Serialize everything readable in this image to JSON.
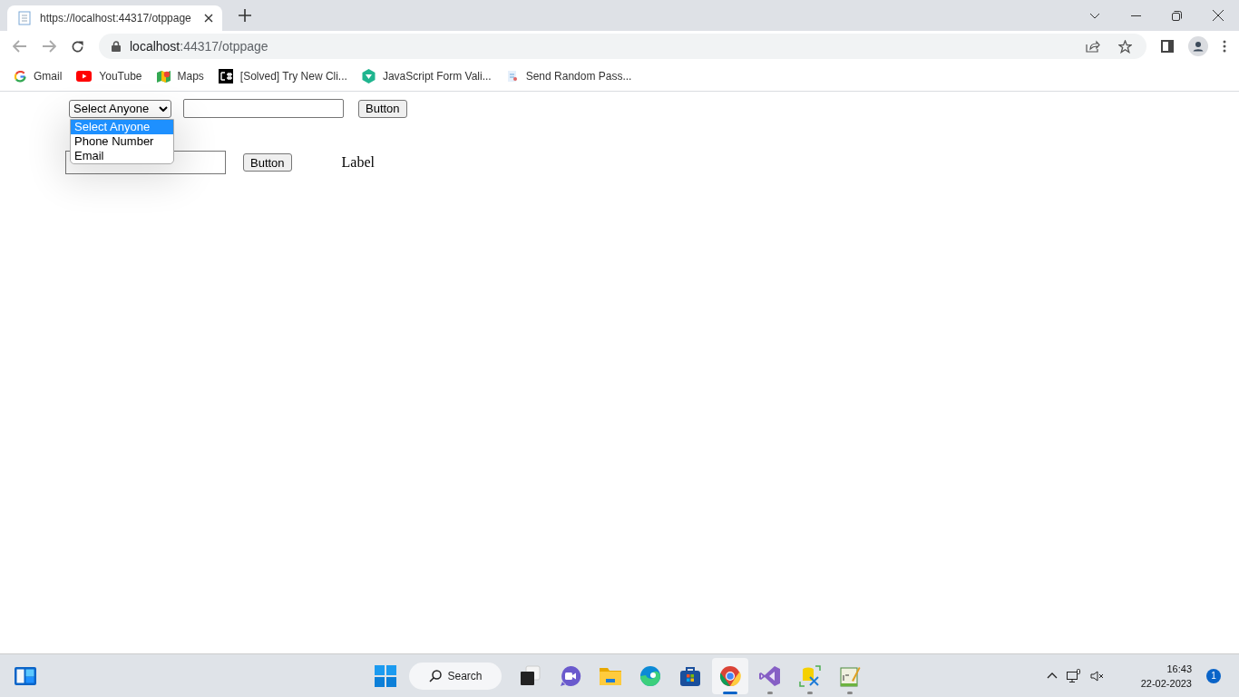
{
  "browser": {
    "tab_title": "https://localhost:44317/otppage",
    "address": {
      "host": "localhost",
      "path": ":44317/otppage"
    },
    "bookmarks": [
      {
        "kind": "google",
        "label": "Gmail"
      },
      {
        "kind": "youtube",
        "label": "YouTube"
      },
      {
        "kind": "maps",
        "label": "Maps"
      },
      {
        "kind": "csharp",
        "label": "[Solved] Try New Cli..."
      },
      {
        "kind": "shield",
        "label": "JavaScript Form Vali..."
      },
      {
        "kind": "page",
        "label": "Send Random Pass..."
      }
    ]
  },
  "page": {
    "select": {
      "value": "Select Anyone",
      "open": true,
      "options": [
        {
          "label": "Select Anyone",
          "selected": true
        },
        {
          "label": "Phone Number",
          "selected": false
        },
        {
          "label": "Email",
          "selected": false
        }
      ]
    },
    "button_1": "Button",
    "button_2": "Button",
    "label": "Label"
  },
  "taskbar": {
    "search": "Search",
    "apps": [
      {
        "kind": "taskview",
        "running": false,
        "active": false
      },
      {
        "kind": "chat",
        "running": false,
        "active": false
      },
      {
        "kind": "folder",
        "running": false,
        "active": false
      },
      {
        "kind": "edge",
        "running": false,
        "active": false
      },
      {
        "kind": "store",
        "running": false,
        "active": false
      },
      {
        "kind": "chrome",
        "running": true,
        "active": true
      },
      {
        "kind": "vs",
        "running": true,
        "active": false
      },
      {
        "kind": "tools",
        "running": true,
        "active": false
      },
      {
        "kind": "notepad",
        "running": true,
        "active": false
      }
    ],
    "time": "16:43",
    "date": "22-02-2023",
    "notifications": "1"
  }
}
